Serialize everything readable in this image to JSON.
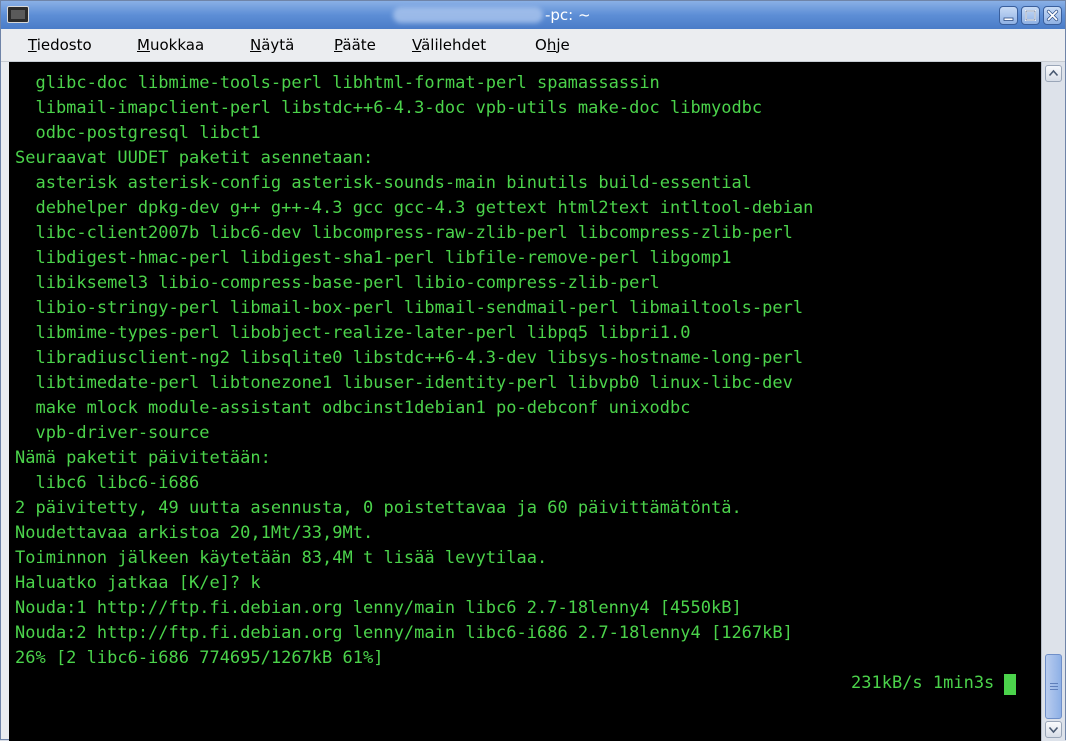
{
  "window": {
    "title": "-pc: ~"
  },
  "menu": [
    {
      "u": "T",
      "rest": "iedosto"
    },
    {
      "u": "M",
      "rest": "uokkaa"
    },
    {
      "u": "N",
      "rest": "äytä"
    },
    {
      "u": "P",
      "rest": "ääte"
    },
    {
      "u": "V",
      "rest": "älilehdet"
    },
    {
      "pre": "O",
      "u": "h",
      "rest": "je"
    }
  ],
  "terminal": {
    "lines": [
      "  glibc-doc libmime-tools-perl libhtml-format-perl spamassassin",
      "  libmail-imapclient-perl libstdc++6-4.3-doc vpb-utils make-doc libmyodbc",
      "  odbc-postgresql libct1",
      "Seuraavat UUDET paketit asennetaan:",
      "  asterisk asterisk-config asterisk-sounds-main binutils build-essential",
      "  debhelper dpkg-dev g++ g++-4.3 gcc gcc-4.3 gettext html2text intltool-debian",
      "  libc-client2007b libc6-dev libcompress-raw-zlib-perl libcompress-zlib-perl",
      "  libdigest-hmac-perl libdigest-sha1-perl libfile-remove-perl libgomp1",
      "  libiksemel3 libio-compress-base-perl libio-compress-zlib-perl",
      "  libio-stringy-perl libmail-box-perl libmail-sendmail-perl libmailtools-perl",
      "  libmime-types-perl libobject-realize-later-perl libpq5 libpri1.0",
      "  libradiusclient-ng2 libsqlite0 libstdc++6-4.3-dev libsys-hostname-long-perl",
      "  libtimedate-perl libtonezone1 libuser-identity-perl libvpb0 linux-libc-dev",
      "  make mlock module-assistant odbcinst1debian1 po-debconf unixodbc",
      "  vpb-driver-source",
      "Nämä paketit päivitetään:",
      "  libc6 libc6-i686",
      "2 päivitetty, 49 uutta asennusta, 0 poistettavaa ja 60 päivittämätöntä.",
      "Noudettavaa arkistoa 20,1Mt/33,9Mt.",
      "Toiminnon jälkeen käytetään 83,4M t lisää levytilaa.",
      "Haluatko jatkaa [K/e]? k",
      "Nouda:1 http://ftp.fi.debian.org lenny/main libc6 2.7-18lenny4 [4550kB]",
      "Nouda:2 http://ftp.fi.debian.org lenny/main libc6-i686 2.7-18lenny4 [1267kB]",
      "26% [2 libc6-i686 774695/1267kB 61%]"
    ],
    "status_right": "231kB/s 1min3s",
    "color": "#4bd34b"
  },
  "icons": {
    "app": "terminal-icon",
    "minimize": "minimize-icon",
    "maximize": "maximize-icon",
    "close": "close-icon"
  }
}
